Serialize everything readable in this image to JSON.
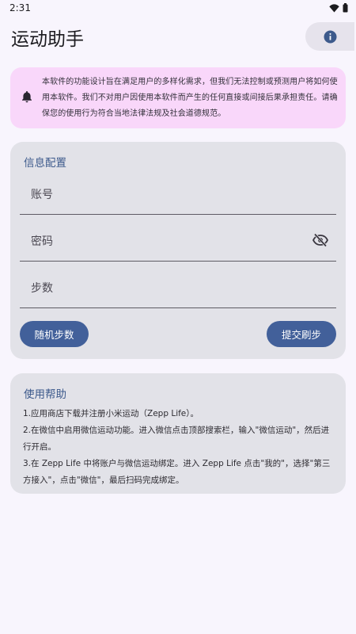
{
  "status_bar": {
    "time": "2:31",
    "icons": [
      "wifi-icon",
      "battery-icon"
    ]
  },
  "app": {
    "title": "运动助手",
    "info_icon": "info-icon"
  },
  "notice": {
    "icon": "bell-icon",
    "text": "本软件的功能设计旨在满足用户的多样化需求，但我们无法控制或预测用户将如何使用本软件。我们不对用户因使用本软件而产生的任何直接或间接后果承担责任。请确保您的使用行为符合当地法律法规及社会道德规范。"
  },
  "config": {
    "title": "信息配置",
    "account_label": "账号",
    "password_label": "密码",
    "password_toggle_icon": "eye-off-icon",
    "steps_label": "步数",
    "random_button": "随机步数",
    "submit_button": "提交刷步"
  },
  "help": {
    "title": "使用帮助",
    "items": [
      "1.应用商店下载并注册小米运动（Zepp Life）。",
      "2.在微信中启用微信运动功能。进入微信点击顶部搜索栏，输入\"微信运动\"，然后进行开启。",
      "3.在 Zepp Life 中将账户与微信运动绑定。进入 Zepp Life 点击\"我的\"，选择\"第三方接入\"，点击\"微信\"，最后扫码完成绑定。"
    ]
  },
  "colors": {
    "background": "#f8f5fd",
    "notice_bg": "#f9d7fa",
    "card_bg": "#e2e2e8",
    "accent": "#42609a",
    "title_accent": "#3d5a8c"
  }
}
